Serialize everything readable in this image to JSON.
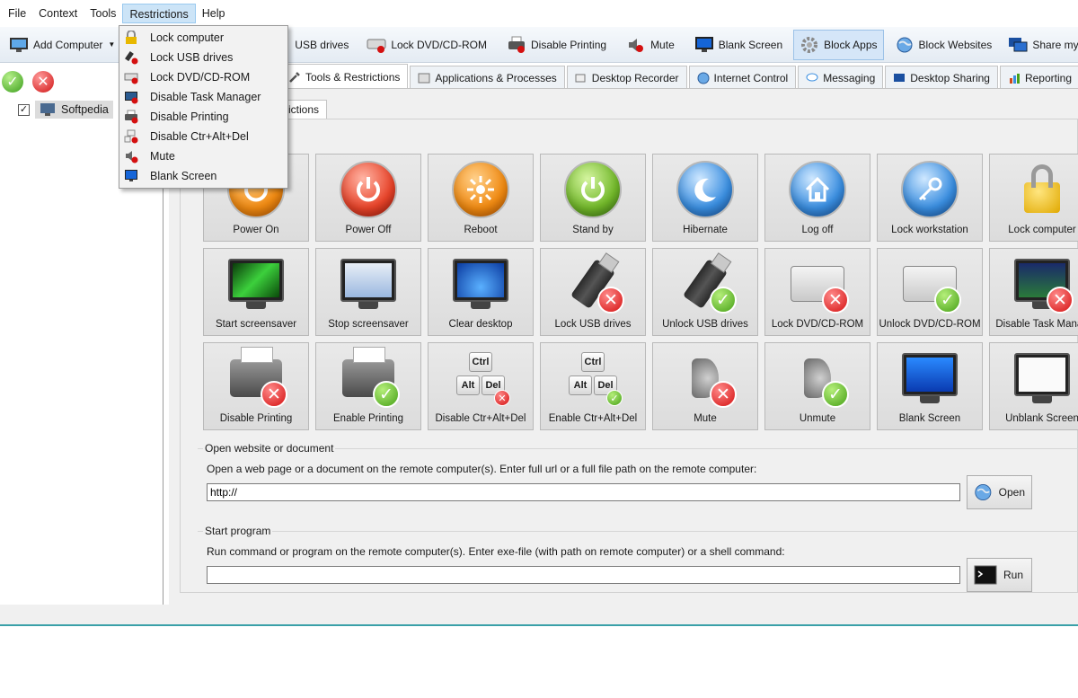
{
  "menu": [
    "File",
    "Context",
    "Tools",
    "Restrictions",
    "Help"
  ],
  "toolbar": {
    "add_computer": "Add Computer",
    "lock_usb": "USB drives",
    "lock_dvd": "Lock DVD/CD-ROM",
    "disable_printing": "Disable Printing",
    "mute": "Mute",
    "blank_screen": "Blank Screen",
    "block_apps": "Block Apps",
    "block_websites": "Block Websites",
    "share_desktop": "Share my Desktop"
  },
  "tree": {
    "computer": "Softpedia",
    "checked": true
  },
  "tabs": [
    "Tools & Restrictions",
    "Applications & Processes",
    "Desktop Recorder",
    "Internet Control",
    "Messaging",
    "Desktop Sharing",
    "Reporting"
  ],
  "subtab": "rictions",
  "tiles": [
    "Power On",
    "Power Off",
    "Reboot",
    "Stand by",
    "Hibernate",
    "Log off",
    "Lock workstation",
    "Lock computer",
    "Start screensaver",
    "Stop screensaver",
    "Clear desktop",
    "Lock USB drives",
    "Unlock USB drives",
    "Lock DVD/CD-ROM",
    "Unlock DVD/CD-ROM",
    "Disable Task Manag",
    "Disable Printing",
    "Enable Printing",
    "Disable Ctr+Alt+Del",
    "Enable Ctr+Alt+Del",
    "Mute",
    "Unmute",
    "Blank Screen",
    "Unblank Screen"
  ],
  "keys": {
    "ctrl": "Ctrl",
    "alt": "Alt",
    "del": "Del"
  },
  "open_section": {
    "title": "Open website or document",
    "desc": "Open a web page or a document on the remote computer(s). Enter full url or a full file path on the remote computer:",
    "value": "http://",
    "button": "Open"
  },
  "run_section": {
    "title": "Start program",
    "desc": "Run command or program on the remote computer(s). Enter exe-file (with path on remote computer) or a shell command:",
    "value": "",
    "button": "Run"
  },
  "restrictions_menu": [
    "Lock computer",
    "Lock USB drives",
    "Lock DVD/CD-ROM",
    "Disable Task Manager",
    "Disable Printing",
    "Disable Ctr+Alt+Del",
    "Mute",
    "Blank Screen"
  ],
  "colors": {
    "accent": "#cce4f7",
    "status_line": "#3aa0a8",
    "ok": "#46a016",
    "error": "#d41010"
  }
}
